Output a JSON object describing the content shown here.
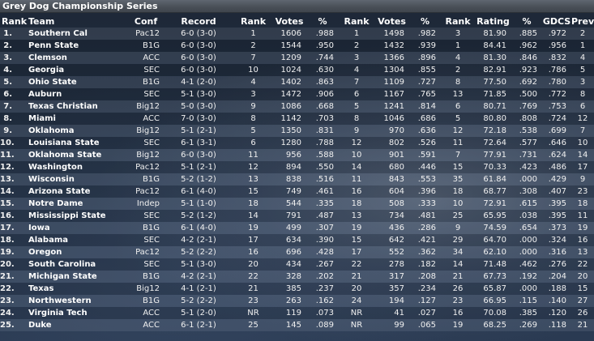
{
  "window": {
    "title": "Grey Dog Championship Series"
  },
  "columns": {
    "rank": "Rank",
    "team": "Team",
    "conf": "Conf",
    "record": "Record",
    "rank2": "Rank",
    "votes2": "Votes",
    "pct2": "%",
    "rank3": "Rank",
    "votes3": "Votes",
    "pct3": "%",
    "rank4": "Rank",
    "rating": "Rating",
    "pct4": "%",
    "gdcs": "GDCS",
    "prev": "Prev"
  },
  "rows": [
    [
      "1.",
      "Southern Cal",
      "Pac12",
      "6-0 (3-0)",
      "1",
      "1606",
      ".988",
      "1",
      "1498",
      ".982",
      "3",
      "81.90",
      ".885",
      ".972",
      "2"
    ],
    [
      "2.",
      "Penn State",
      "B1G",
      "6-0 (3-0)",
      "2",
      "1544",
      ".950",
      "2",
      "1432",
      ".939",
      "1",
      "84.41",
      ".962",
      ".956",
      "1"
    ],
    [
      "3.",
      "Clemson",
      "ACC",
      "6-0 (3-0)",
      "7",
      "1209",
      ".744",
      "3",
      "1366",
      ".896",
      "4",
      "81.30",
      ".846",
      ".832",
      "4"
    ],
    [
      "4.",
      "Georgia",
      "SEC",
      "6-0 (3-0)",
      "10",
      "1024",
      ".630",
      "4",
      "1304",
      ".855",
      "2",
      "82.91",
      ".923",
      ".786",
      "5"
    ],
    [
      "5.",
      "Ohio State",
      "B1G",
      "4-1 (2-0)",
      "4",
      "1402",
      ".863",
      "7",
      "1109",
      ".727",
      "8",
      "77.50",
      ".692",
      ".780",
      "3"
    ],
    [
      "6.",
      "Auburn",
      "SEC",
      "5-1 (3-0)",
      "3",
      "1472",
      ".906",
      "6",
      "1167",
      ".765",
      "13",
      "71.85",
      ".500",
      ".772",
      "8"
    ],
    [
      "7.",
      "Texas Christian",
      "Big12",
      "5-0 (3-0)",
      "9",
      "1086",
      ".668",
      "5",
      "1241",
      ".814",
      "6",
      "80.71",
      ".769",
      ".753",
      "6"
    ],
    [
      "8.",
      "Miami",
      "ACC",
      "7-0 (3-0)",
      "8",
      "1142",
      ".703",
      "8",
      "1046",
      ".686",
      "5",
      "80.80",
      ".808",
      ".724",
      "12"
    ],
    [
      "9.",
      "Oklahoma",
      "Big12",
      "5-1 (2-1)",
      "5",
      "1350",
      ".831",
      "9",
      "970",
      ".636",
      "12",
      "72.18",
      ".538",
      ".699",
      "7"
    ],
    [
      "10.",
      "Louisiana State",
      "SEC",
      "6-1 (3-1)",
      "6",
      "1280",
      ".788",
      "12",
      "802",
      ".526",
      "11",
      "72.64",
      ".577",
      ".646",
      "10"
    ],
    [
      "11.",
      "Oklahoma State",
      "Big12",
      "6-0 (3-0)",
      "11",
      "956",
      ".588",
      "10",
      "901",
      ".591",
      "7",
      "77.91",
      ".731",
      ".624",
      "14"
    ],
    [
      "12.",
      "Washington",
      "Pac12",
      "5-1 (2-1)",
      "12",
      "894",
      ".550",
      "14",
      "680",
      ".446",
      "15",
      "70.33",
      ".423",
      ".486",
      "17"
    ],
    [
      "13.",
      "Wisconsin",
      "B1G",
      "5-2 (1-2)",
      "13",
      "838",
      ".516",
      "11",
      "843",
      ".553",
      "35",
      "61.84",
      ".000",
      ".429",
      "9"
    ],
    [
      "14.",
      "Arizona State",
      "Pac12",
      "6-1 (4-0)",
      "15",
      "749",
      ".461",
      "16",
      "604",
      ".396",
      "18",
      "68.77",
      ".308",
      ".407",
      "23"
    ],
    [
      "15.",
      "Notre Dame",
      "Indep",
      "5-1 (1-0)",
      "18",
      "544",
      ".335",
      "18",
      "508",
      ".333",
      "10",
      "72.91",
      ".615",
      ".395",
      "18"
    ],
    [
      "16.",
      "Mississippi State",
      "SEC",
      "5-2 (1-2)",
      "14",
      "791",
      ".487",
      "13",
      "734",
      ".481",
      "25",
      "65.95",
      ".038",
      ".395",
      "11"
    ],
    [
      "17.",
      "Iowa",
      "B1G",
      "6-1 (4-0)",
      "19",
      "499",
      ".307",
      "19",
      "436",
      ".286",
      "9",
      "74.59",
      ".654",
      ".373",
      "19"
    ],
    [
      "18.",
      "Alabama",
      "SEC",
      "4-2 (2-1)",
      "17",
      "634",
      ".390",
      "15",
      "642",
      ".421",
      "29",
      "64.70",
      ".000",
      ".324",
      "16"
    ],
    [
      "19.",
      "Oregon",
      "Pac12",
      "5-2 (2-2)",
      "16",
      "696",
      ".428",
      "17",
      "552",
      ".362",
      "34",
      "62.10",
      ".000",
      ".316",
      "13"
    ],
    [
      "20.",
      "South Carolina",
      "SEC",
      "5-1 (3-0)",
      "20",
      "434",
      ".267",
      "22",
      "278",
      ".182",
      "14",
      "71.48",
      ".462",
      ".276",
      "22"
    ],
    [
      "21.",
      "Michigan State",
      "B1G",
      "4-2 (2-1)",
      "22",
      "328",
      ".202",
      "21",
      "317",
      ".208",
      "21",
      "67.73",
      ".192",
      ".204",
      "20"
    ],
    [
      "22.",
      "Texas",
      "Big12",
      "4-1 (2-1)",
      "21",
      "385",
      ".237",
      "20",
      "357",
      ".234",
      "26",
      "65.87",
      ".000",
      ".188",
      "15"
    ],
    [
      "23.",
      "Northwestern",
      "B1G",
      "5-2 (2-2)",
      "23",
      "263",
      ".162",
      "24",
      "194",
      ".127",
      "23",
      "66.95",
      ".115",
      ".140",
      "27"
    ],
    [
      "24.",
      "Virginia Tech",
      "ACC",
      "5-1 (2-0)",
      "NR",
      "119",
      ".073",
      "NR",
      "41",
      ".027",
      "16",
      "70.08",
      ".385",
      ".120",
      "26"
    ],
    [
      "25.",
      "Duke",
      "ACC",
      "6-1 (2-1)",
      "25",
      "145",
      ".089",
      "NR",
      "99",
      ".065",
      "19",
      "68.25",
      ".269",
      ".118",
      "21"
    ]
  ]
}
